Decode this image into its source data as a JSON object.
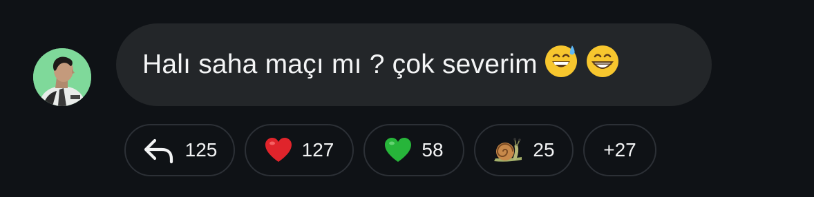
{
  "message": {
    "text": "Halı saha maçı mı ? çok severim",
    "emojis": [
      "grinning-face-with-sweat",
      "beaming-face-with-smiling-eyes"
    ]
  },
  "avatar": {
    "background_color": "#7fd99a"
  },
  "reactions": [
    {
      "icon": "reply-arrow-icon",
      "count": "125"
    },
    {
      "icon": "red-heart-icon",
      "count": "127"
    },
    {
      "icon": "green-heart-icon",
      "count": "58"
    },
    {
      "icon": "snail-icon",
      "count": "25"
    }
  ],
  "more_reactions": "+27",
  "colors": {
    "background": "#0f1216",
    "bubble": "#232629",
    "chip_border": "#2c3036",
    "red_heart": "#e0242b",
    "green_heart": "#27b53a"
  }
}
